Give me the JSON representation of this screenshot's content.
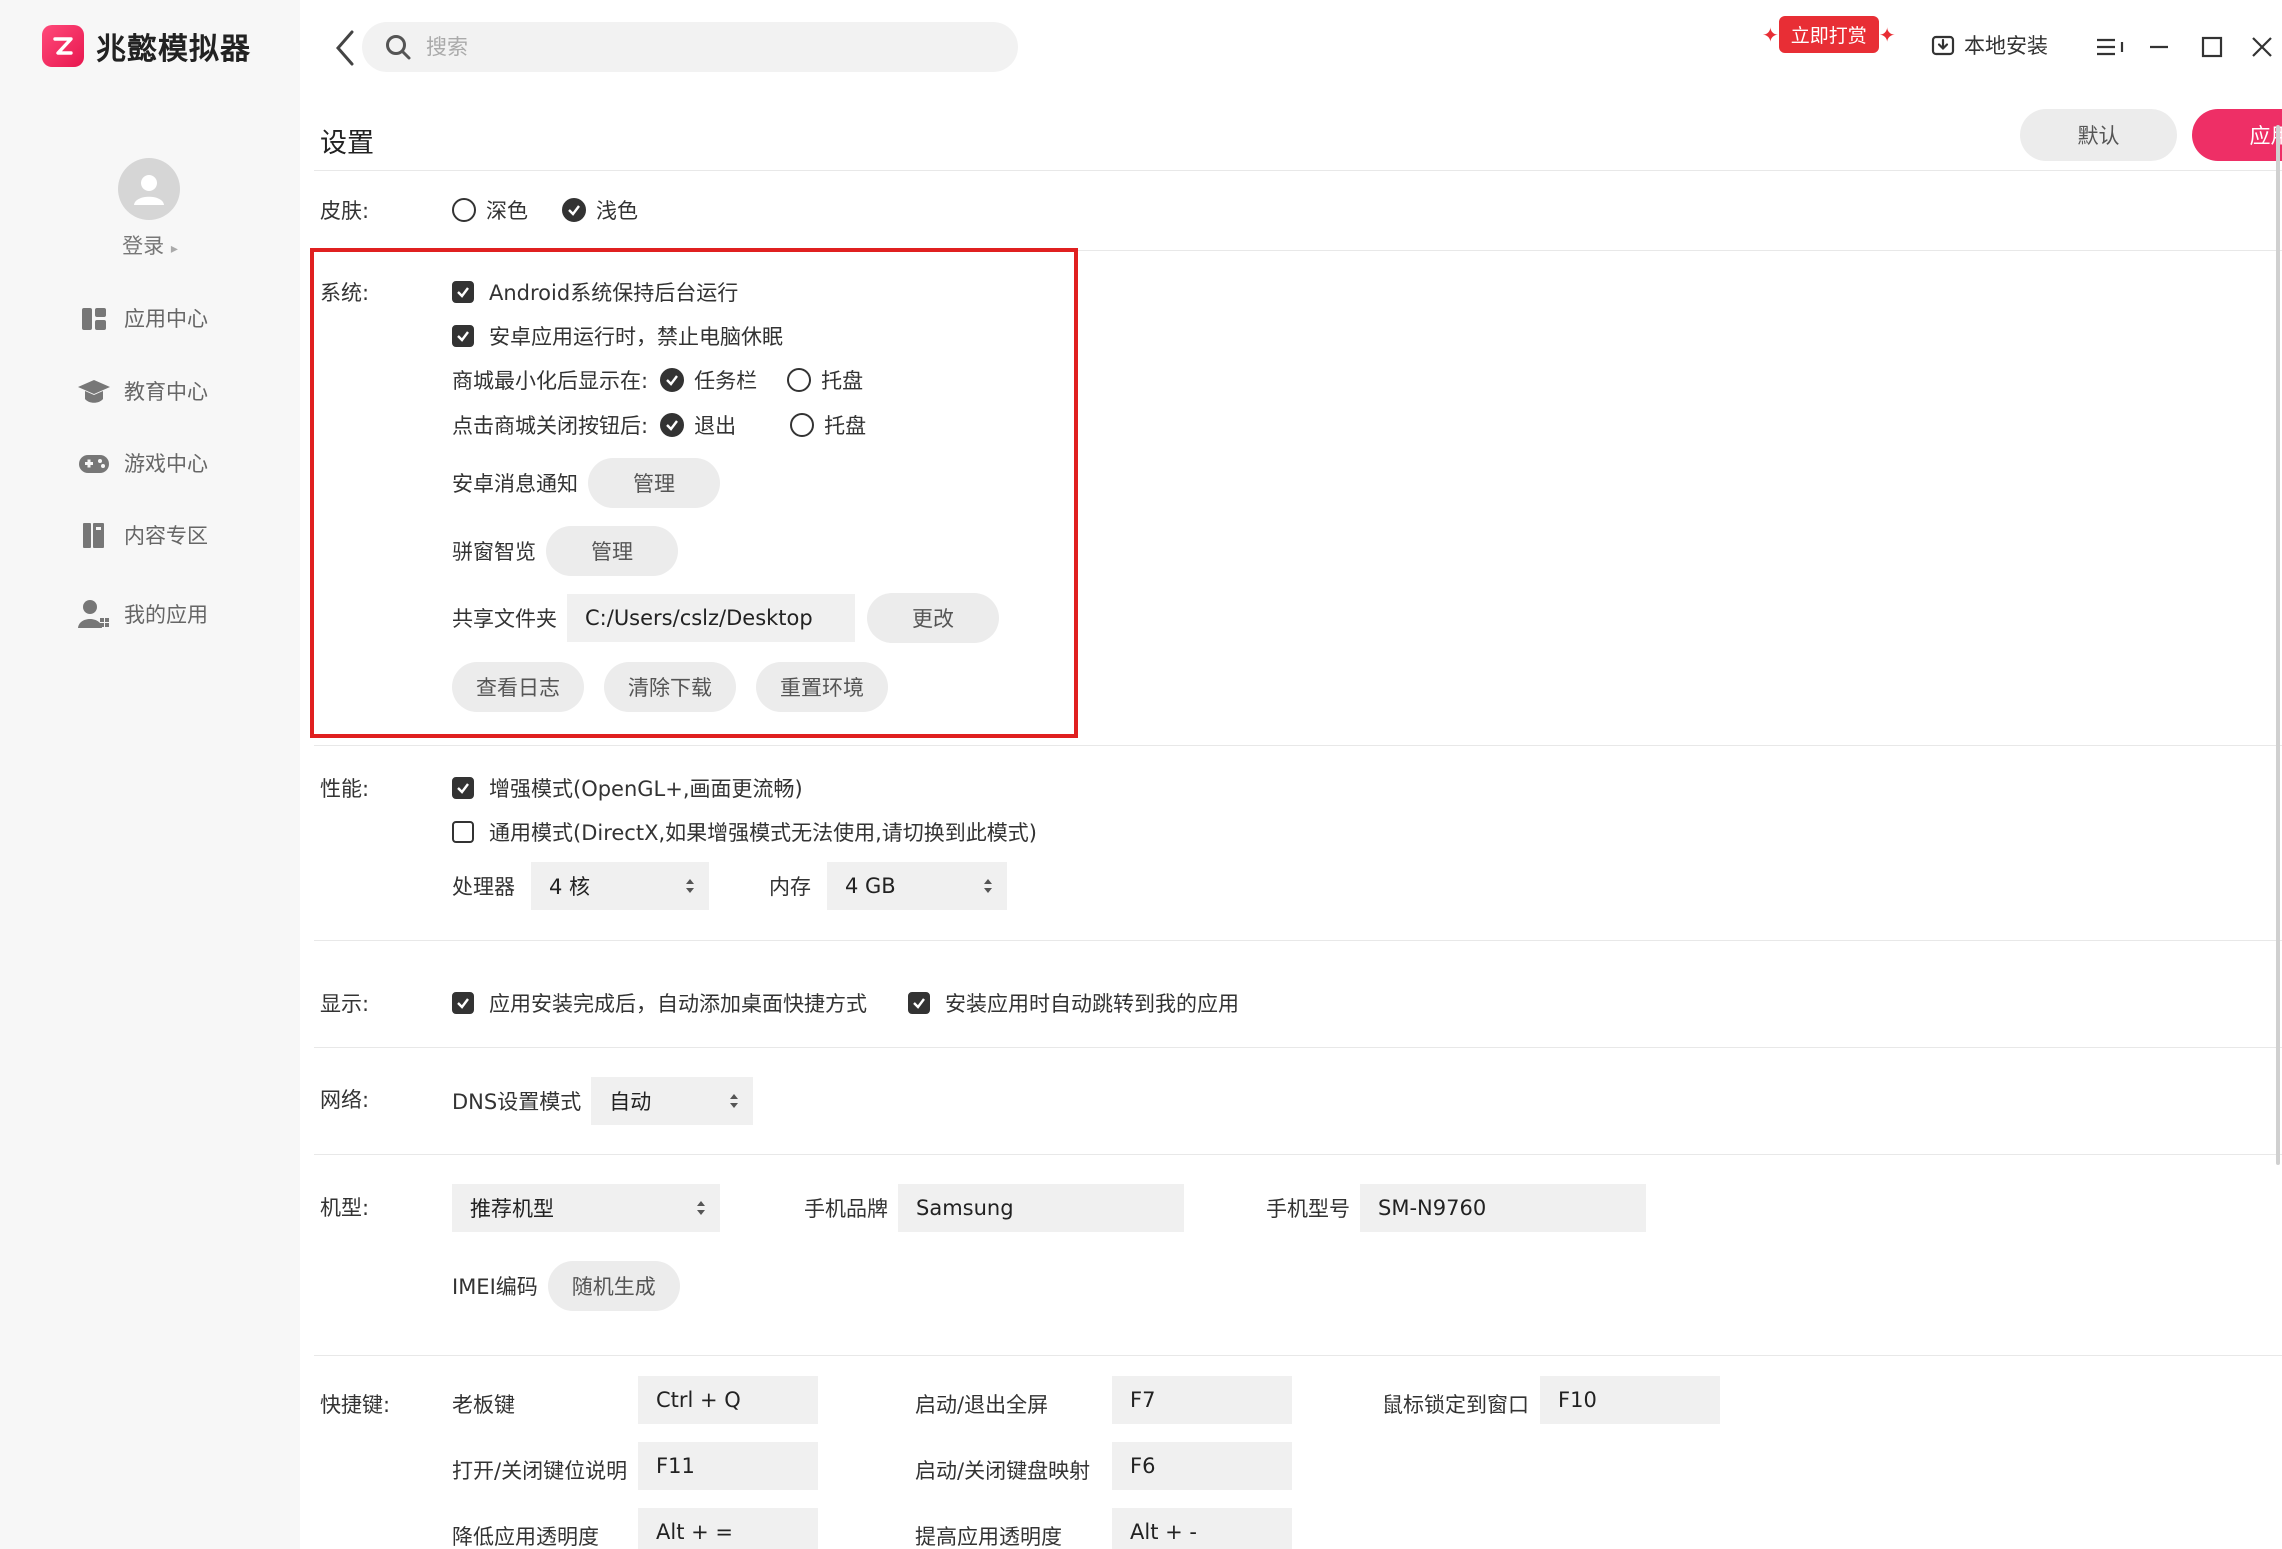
{
  "app": {
    "name": "兆懿模拟器"
  },
  "sidebar": {
    "login": "登录",
    "login_arrow": "▸",
    "items": [
      {
        "label": "应用中心",
        "icon": "apps-icon"
      },
      {
        "label": "教育中心",
        "icon": "graduation-cap-icon"
      },
      {
        "label": "游戏中心",
        "icon": "gamepad-icon"
      },
      {
        "label": "内容专区",
        "icon": "books-icon"
      },
      {
        "label": "我的应用",
        "icon": "user-apps-icon"
      }
    ]
  },
  "topbar": {
    "search_placeholder": "搜索",
    "reward_label": "立即打赏",
    "local_install": "本地安装"
  },
  "settings": {
    "title": "设置",
    "default_button": "默认",
    "apply_button": "应用",
    "skin": {
      "label": "皮肤:",
      "options": [
        {
          "label": "深色",
          "selected": false
        },
        {
          "label": "浅色",
          "selected": true
        }
      ]
    },
    "system": {
      "label": "系统:",
      "keep_background": {
        "label": "Android系统保持后台运行",
        "checked": true
      },
      "no_sleep": {
        "label": "安卓应用运行时，禁止电脑休眠",
        "checked": true
      },
      "minimize_to": {
        "label": "商城最小化后显示在:",
        "options": [
          {
            "label": "任务栏",
            "selected": true
          },
          {
            "label": "托盘",
            "selected": false
          }
        ]
      },
      "close_action": {
        "label": "点击商城关闭按钮后:",
        "options": [
          {
            "label": "退出",
            "selected": true
          },
          {
            "label": "托盘",
            "selected": false
          }
        ]
      },
      "notifications": {
        "label": "安卓消息通知",
        "button": "管理"
      },
      "smart_view": {
        "label": "骈窗智览",
        "button": "管理"
      },
      "shared_folder": {
        "label": "共享文件夹",
        "value": "C:/Users/cslz/Desktop",
        "button": "更改"
      },
      "buttons": {
        "logs": "查看日志",
        "clear_downloads": "清除下载",
        "reset_env": "重置环境"
      }
    },
    "performance": {
      "label": "性能:",
      "enhanced": {
        "label": "增强模式(OpenGL+,画面更流畅)",
        "checked": true
      },
      "general": {
        "label": "通用模式(DirectX,如果增强模式无法使用,请切换到此模式)",
        "checked": false
      },
      "cpu": {
        "label": "处理器",
        "value": "4 核"
      },
      "memory": {
        "label": "内存",
        "value": "4 GB"
      }
    },
    "display": {
      "label": "显示:",
      "shortcut": {
        "label": "应用安装完成后，自动添加桌面快捷方式",
        "checked": true
      },
      "jump": {
        "label": "安装应用时自动跳转到我的应用",
        "checked": true
      }
    },
    "network": {
      "label": "网络:",
      "dns": {
        "label": "DNS设置模式",
        "value": "自动"
      }
    },
    "device": {
      "label": "机型:",
      "model_select": "推荐机型",
      "brand_label": "手机品牌",
      "brand_value": "Samsung",
      "model_label": "手机型号",
      "model_value": "SM-N9760",
      "imei_label": "IMEI编码",
      "imei_button": "随机生成"
    },
    "hotkeys": {
      "label": "快捷键:",
      "items": [
        {
          "label": "老板键",
          "value": "Ctrl + Q"
        },
        {
          "label": "启动/退出全屏",
          "value": "F7"
        },
        {
          "label": "鼠标锁定到窗口",
          "value": "F10"
        },
        {
          "label": "打开/关闭键位说明",
          "value": "F11"
        },
        {
          "label": "启动/关闭键盘映射",
          "value": "F6"
        },
        {
          "label": "降低应用透明度",
          "value": "Alt + ="
        },
        {
          "label": "提高应用透明度",
          "value": "Alt + -"
        }
      ]
    }
  },
  "colors": {
    "accent": "#ee2f66",
    "highlight_border": "#e02020",
    "reward": "#e82e35"
  }
}
